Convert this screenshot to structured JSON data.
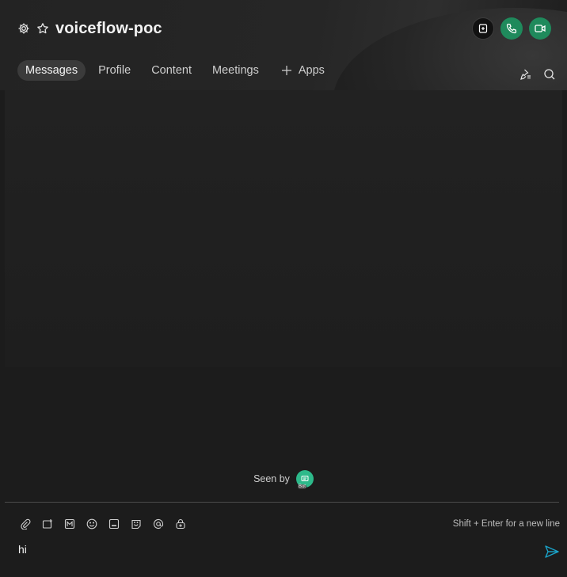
{
  "header": {
    "title": "voiceflow-poc",
    "icons": [
      "gear-icon",
      "star-icon",
      "add-to-space-icon",
      "phone-icon",
      "video-icon"
    ]
  },
  "tabs": [
    {
      "label": "Messages",
      "active": true
    },
    {
      "label": "Profile",
      "active": false
    },
    {
      "label": "Content",
      "active": false
    },
    {
      "label": "Meetings",
      "active": false
    }
  ],
  "apps_label": "Apps",
  "seen": {
    "label": "Seen by",
    "avatar_badge": "Bot"
  },
  "composer": {
    "hint": "Shift + Enter for a new line",
    "value": "hi",
    "tools": [
      "attach-icon",
      "screenshot-icon",
      "markdown-icon",
      "emoji-icon",
      "gif-icon",
      "sticker-icon",
      "mention-icon",
      "secure-icon"
    ]
  },
  "colors": {
    "green": "#1f8a5c",
    "send": "#1aa3c9",
    "background": "#1c1c1c"
  }
}
